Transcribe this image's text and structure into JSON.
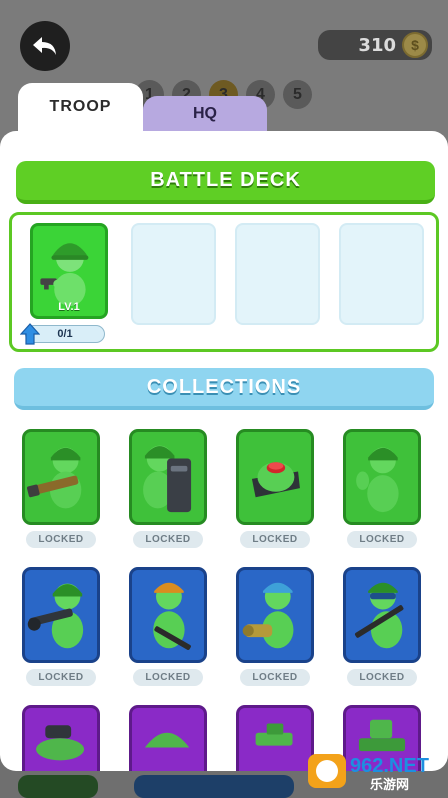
{
  "header": {
    "coins": "310",
    "coin_symbol": "$",
    "levels": [
      "1",
      "2",
      "3",
      "4",
      "5"
    ]
  },
  "tabs": [
    {
      "label": "TROOP",
      "active": true
    },
    {
      "label": "HQ",
      "active": false
    }
  ],
  "battle_deck": {
    "title": "BATTLE DECK",
    "card": {
      "level": "LV.1",
      "progress": "0/1"
    },
    "empty_slots": 3
  },
  "collections": {
    "title": "COLLECTIONS",
    "units": [
      {
        "status": "LOCKED",
        "color": "green",
        "weapon": "bazooka"
      },
      {
        "status": "LOCKED",
        "color": "green",
        "weapon": "riot-shield"
      },
      {
        "status": "LOCKED",
        "color": "green",
        "weapon": "landmine"
      },
      {
        "status": "LOCKED",
        "color": "green",
        "weapon": "grenade"
      },
      {
        "status": "LOCKED",
        "color": "blue",
        "weapon": "mortar"
      },
      {
        "status": "LOCKED",
        "color": "blue",
        "weapon": "rifle"
      },
      {
        "status": "LOCKED",
        "color": "blue",
        "weapon": "flamethrower"
      },
      {
        "status": "LOCKED",
        "color": "blue",
        "weapon": "sniper"
      },
      {
        "status": "",
        "color": "purple",
        "weapon": "cannon"
      },
      {
        "status": "",
        "color": "purple",
        "weapon": "helmet"
      },
      {
        "status": "",
        "color": "purple",
        "weapon": "turret"
      },
      {
        "status": "",
        "color": "purple",
        "weapon": "tank"
      }
    ]
  },
  "colors": {
    "green_banner": "#5fcf25",
    "blue_banner": "#8fd5f0",
    "card_green": "#3fc13a",
    "card_blue": "#2a67c7",
    "card_purple": "#8a2ac7"
  },
  "watermark": {
    "text": "962.NET",
    "subtext": "乐游网"
  }
}
